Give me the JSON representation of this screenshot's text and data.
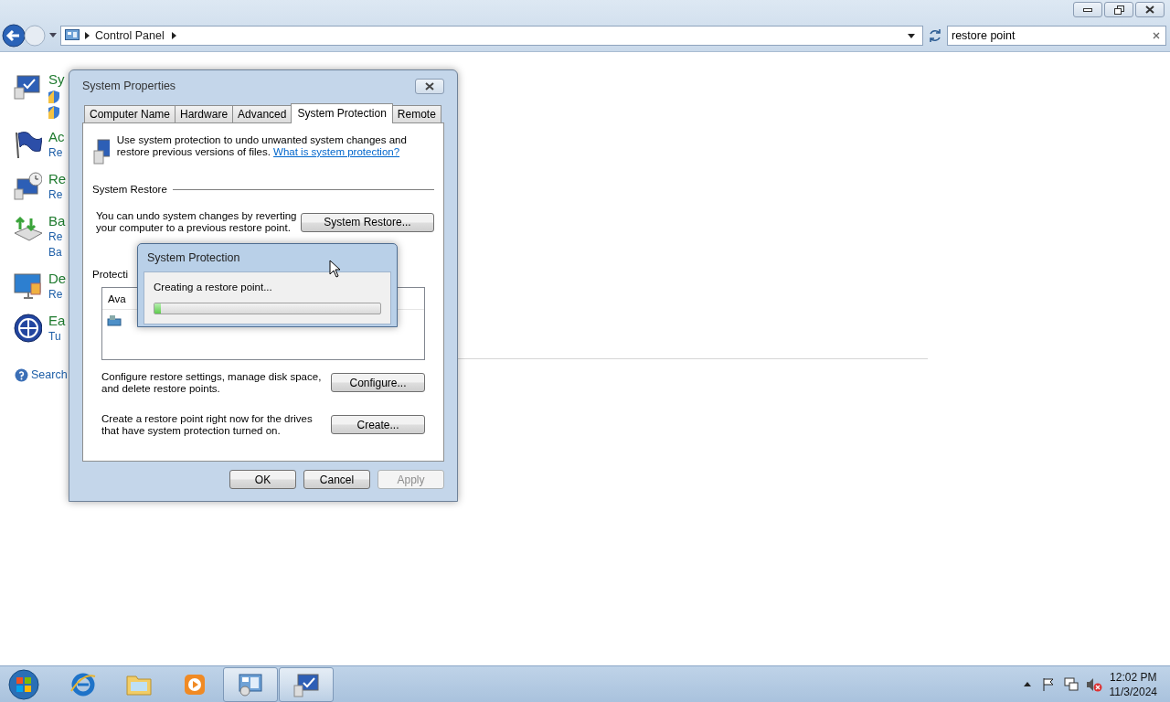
{
  "explorer": {
    "breadcrumb": [
      "Control Panel"
    ],
    "search_value": "restore point",
    "results": [
      {
        "kind": "system",
        "title": "Sy",
        "links": [
          {
            "kind": "shield"
          },
          {
            "kind": "shield"
          }
        ]
      },
      {
        "kind": "flag",
        "title": "Ac",
        "links": [
          {
            "kind": "link",
            "text": "Re"
          }
        ]
      },
      {
        "kind": "recovery",
        "title": "Re",
        "links": [
          {
            "kind": "link",
            "text": "Re"
          }
        ]
      },
      {
        "kind": "backup",
        "title": "Ba",
        "links": [
          {
            "kind": "link",
            "text": "Re"
          },
          {
            "kind": "link",
            "text": "Ba"
          }
        ]
      },
      {
        "kind": "display",
        "title": "De",
        "links": [
          {
            "kind": "link",
            "text": "Re"
          }
        ]
      },
      {
        "kind": "ease",
        "title": "Ea",
        "links": [
          {
            "kind": "link",
            "text": "Tu"
          }
        ]
      }
    ],
    "help_link": "Search"
  },
  "dialog": {
    "title": "System Properties",
    "tabs": [
      {
        "label": "Computer Name",
        "selected": false
      },
      {
        "label": "Hardware",
        "selected": false
      },
      {
        "label": "Advanced",
        "selected": false
      },
      {
        "label": "System Protection",
        "selected": true
      },
      {
        "label": "Remote",
        "selected": false
      }
    ],
    "intro": "Use system protection to undo unwanted system changes and restore previous versions of files.",
    "intro_link": "What is system protection?",
    "restore_heading": "System Restore",
    "restore_text": "You can undo system changes by reverting your computer to a previous restore point.",
    "restore_button": "System Restore...",
    "protection_heading": "Protecti",
    "list_header": "Ava",
    "configure_text": "Configure restore settings, manage disk space, and delete restore points.",
    "configure_button": "Configure...",
    "create_text": "Create a restore point right now for the drives that have system protection turned on.",
    "create_button": "Create...",
    "footer_buttons": [
      {
        "label": "OK",
        "disabled": false
      },
      {
        "label": "Cancel",
        "disabled": false
      },
      {
        "label": "Apply",
        "disabled": true
      }
    ]
  },
  "progress_dialog": {
    "title": "System Protection",
    "message": "Creating a restore point...",
    "level": 0.03
  },
  "taskbar": {
    "items": [
      {
        "kind": "browser",
        "selected": false
      },
      {
        "kind": "folder",
        "selected": false
      },
      {
        "kind": "media",
        "selected": false
      },
      {
        "kind": "control-panel",
        "selected": true
      },
      {
        "kind": "system",
        "selected": true
      }
    ],
    "time": "12:02 PM",
    "date": "11/3/2024"
  }
}
